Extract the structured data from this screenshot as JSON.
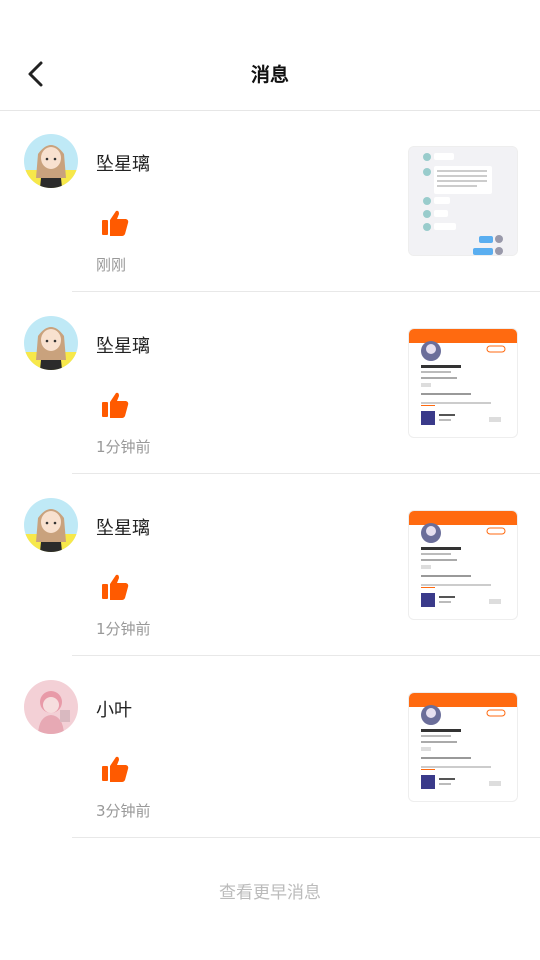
{
  "header": {
    "title": "消息"
  },
  "icons": {
    "back": "chevron-left-icon",
    "like": "thumbs-up-icon"
  },
  "colors": {
    "accent": "#ff5a00",
    "muted": "#999999",
    "more": "#bbbbbb"
  },
  "messages": [
    {
      "name": "坠星璃",
      "time": "刚刚",
      "avatar": "anime-girl",
      "thumb": "chat"
    },
    {
      "name": "坠星璃",
      "time": "1分钟前",
      "avatar": "anime-girl",
      "thumb": "profile"
    },
    {
      "name": "坠星璃",
      "time": "1分钟前",
      "avatar": "anime-girl",
      "thumb": "profile"
    },
    {
      "name": "小叶",
      "time": "3分钟前",
      "avatar": "pink-boy",
      "thumb": "profile"
    }
  ],
  "footer": {
    "more_label": "查看更早消息"
  }
}
